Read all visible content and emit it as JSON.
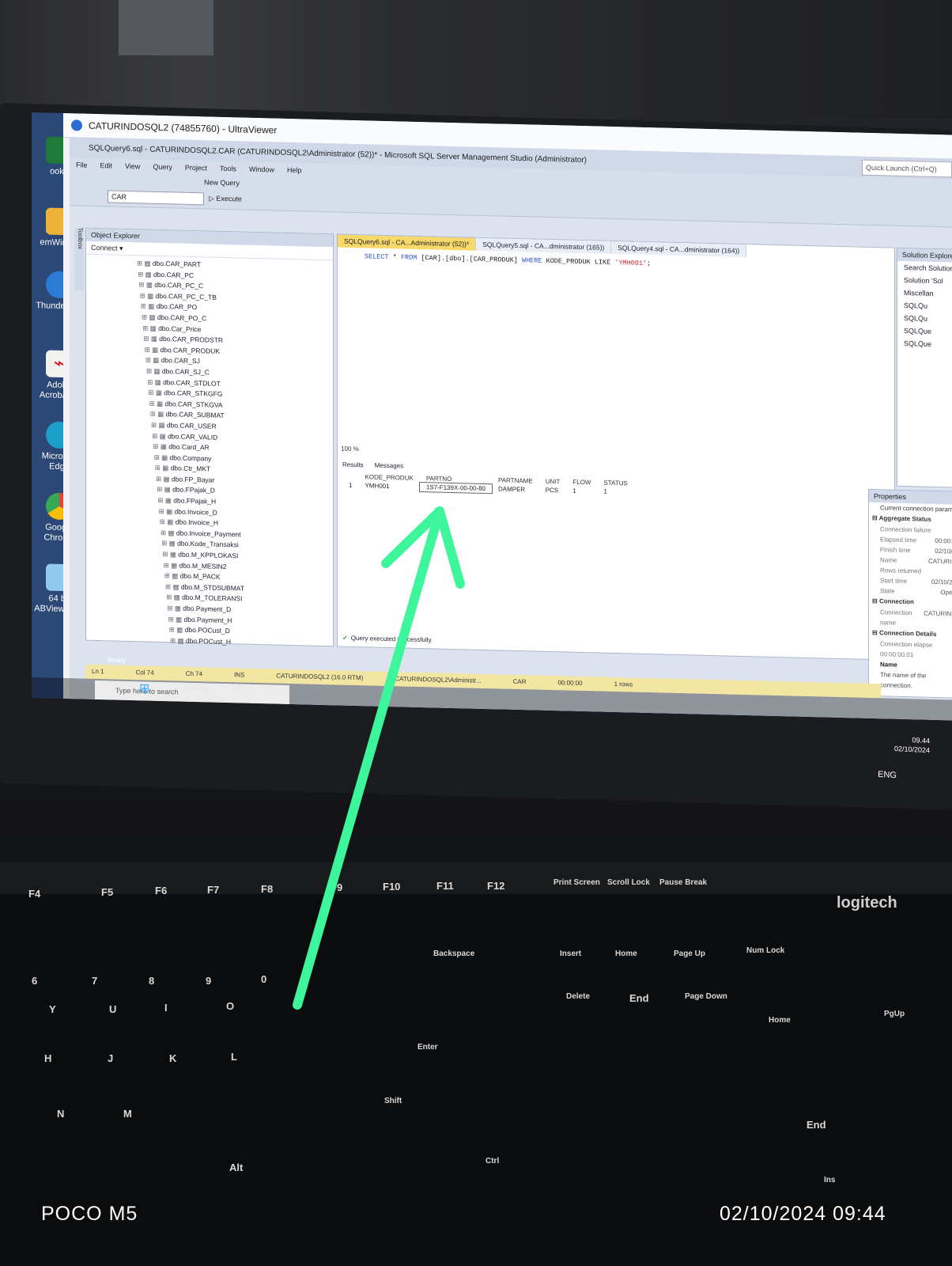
{
  "uv_title": "CATURINDOSQL2 (74855760) - UltraViewer",
  "ssms_title": "SQLQuery6.sql - CATURINDOSQL2.CAR (CATURINDOSQL2\\Administrator (52))* - Microsoft SQL Server Management Studio (Administrator)",
  "quick_launch": "Quick Launch (Ctrl+Q)",
  "menu": [
    "File",
    "Edit",
    "View",
    "Query",
    "Project",
    "Tools",
    "Window",
    "Help"
  ],
  "toolbar": {
    "new_query": "New Query",
    "database": "CAR",
    "execute": "Execute"
  },
  "object_explorer": {
    "title": "Object Explorer",
    "connect": "Connect ▾",
    "tables": [
      "dbo.CAR_PART",
      "dbo.CAR_PC",
      "dbo.CAR_PC_C",
      "dbo.CAR_PC_C_TB",
      "dbo.CAR_PO",
      "dbo.CAR_PO_C",
      "dbo.Car_Price",
      "dbo.CAR_PRODSTR",
      "dbo.CAR_PRODUK",
      "dbo.CAR_SJ",
      "dbo.CAR_SJ_C",
      "dbo.CAR_STDLOT",
      "dbo.CAR_STKGFG",
      "dbo.CAR_STKGVA",
      "dbo.CAR_SUBMAT",
      "dbo.CAR_USER",
      "dbo.CAR_VALID",
      "dbo.Card_AR",
      "dbo.Company",
      "dbo.Ctr_MKT",
      "dbo.FP_Bayar",
      "dbo.FPajak_D",
      "dbo.FPajak_H",
      "dbo.Invoice_D",
      "dbo.Invoice_H",
      "dbo.Invoice_Payment",
      "dbo.Kode_Transaksi",
      "dbo.M_KPPLOKASI",
      "dbo.M_MESIN2",
      "dbo.M_PACK",
      "dbo.M_STDSUBMAT",
      "dbo.M_TOLERANSI",
      "dbo.Payment_D",
      "dbo.Payment_H",
      "dbo.POCust_D",
      "dbo.POCust_H"
    ]
  },
  "toolbox": "Toolbox",
  "editor_tabs": [
    "SQLQuery6.sql - CA...Administrator (52))*",
    "SQLQuery5.sql - CA...dministrator (165))",
    "SQLQuery4.sql - CA...dministrator (164))"
  ],
  "query": {
    "select": "SELECT",
    "star": "*",
    "from": "FROM",
    "table": "[CAR].[dbo].[CAR_PRODUK]",
    "where": "WHERE",
    "column": "KODE_PRODUK",
    "like": "LIKE",
    "value": "'YMH001'",
    "semicolon": ";"
  },
  "zoom": "100 %",
  "results_tabs": {
    "results": "Results",
    "messages": "Messages"
  },
  "grid": {
    "columns": [
      "",
      "KODE_PRODUK",
      "PARTNO",
      "PARTNAME",
      "UNIT",
      "FLOW",
      "STATUS"
    ],
    "rows": [
      [
        "1",
        "YMH001",
        "1S7-F139X-00-00-80",
        "DAMPER",
        "PCS",
        "1",
        "1"
      ]
    ]
  },
  "query_status": "Query executed successfully.",
  "status_bar": {
    "server": "CATURINDOSQL2 (16.0 RTM)",
    "login": "CATURINDOSQL2\\Administr...",
    "db": "CAR",
    "time": "00:00:00",
    "rows": "1 rows",
    "ln": "Ln 1",
    "col": "Col 74",
    "ch": "Ch 74",
    "ins": "INS"
  },
  "ready": "Ready",
  "solution_explorer": {
    "title": "Solution Explorer",
    "search": "Search Solution E",
    "items": [
      "Solution 'Sol",
      "Miscellan",
      "SQLQu",
      "SQLQu",
      "SQLQue",
      "SQLQue"
    ]
  },
  "properties": {
    "title": "Properties",
    "subtitle": "Current connection param",
    "sections": {
      "aggregate": "Aggregate Status",
      "connection": "Connection",
      "details": "Connection Details"
    },
    "aggregate_rows": [
      [
        "Connection failure",
        ""
      ],
      [
        "Elapsed time",
        "00:00:0"
      ],
      [
        "Finish time",
        "02/10/2"
      ],
      [
        "Name",
        "CATURIN"
      ],
      [
        "Rows returned",
        "1"
      ],
      [
        "Start time",
        "02/10/20"
      ],
      [
        "State",
        "Open"
      ]
    ],
    "connection_name": [
      "Connection name",
      "CATURIND"
    ],
    "elapsed_label": "Connection elapse 00:00:00.01",
    "name_label": "Name",
    "name_desc": "The name of the connection."
  },
  "desktop_icons": [
    "ook1",
    "emWinP...",
    "Thunderbird",
    "Adobe Acrobat ...",
    "Microsoft Edge",
    "Google Chrome",
    "64 bit ABViewer 14"
  ],
  "remote_search": "Type here to search",
  "outer_search": "Search",
  "clock": {
    "time": "09.44",
    "date": "02/10/2024"
  },
  "lang": "ENG",
  "keyboard": {
    "brand": "logitech",
    "keys": [
      "F4",
      "F5",
      "F6",
      "F7",
      "F8",
      "F9",
      "F10",
      "F11",
      "F12",
      "Print Screen",
      "Scroll Lock",
      "Pause Break",
      "Backspace",
      "Insert",
      "Home",
      "Page Up",
      "Num Lock",
      "Delete",
      "End",
      "Page Down",
      "Enter",
      "Shift",
      "Alt",
      "Ctrl",
      "Y",
      "U",
      "I",
      "O",
      "H",
      "J",
      "K",
      "L",
      "N",
      "M",
      "6",
      "7",
      "8",
      "9",
      "0",
      "Home",
      "PgUp",
      "End",
      "Ins"
    ]
  },
  "camera": "POCO M5",
  "photo_stamp": "02/10/2024  09:44",
  "colors": {
    "arrow": "#3df59a",
    "active_tab": "#f6d86b",
    "keyword": "#2b4fd3",
    "string": "#dd2222"
  }
}
